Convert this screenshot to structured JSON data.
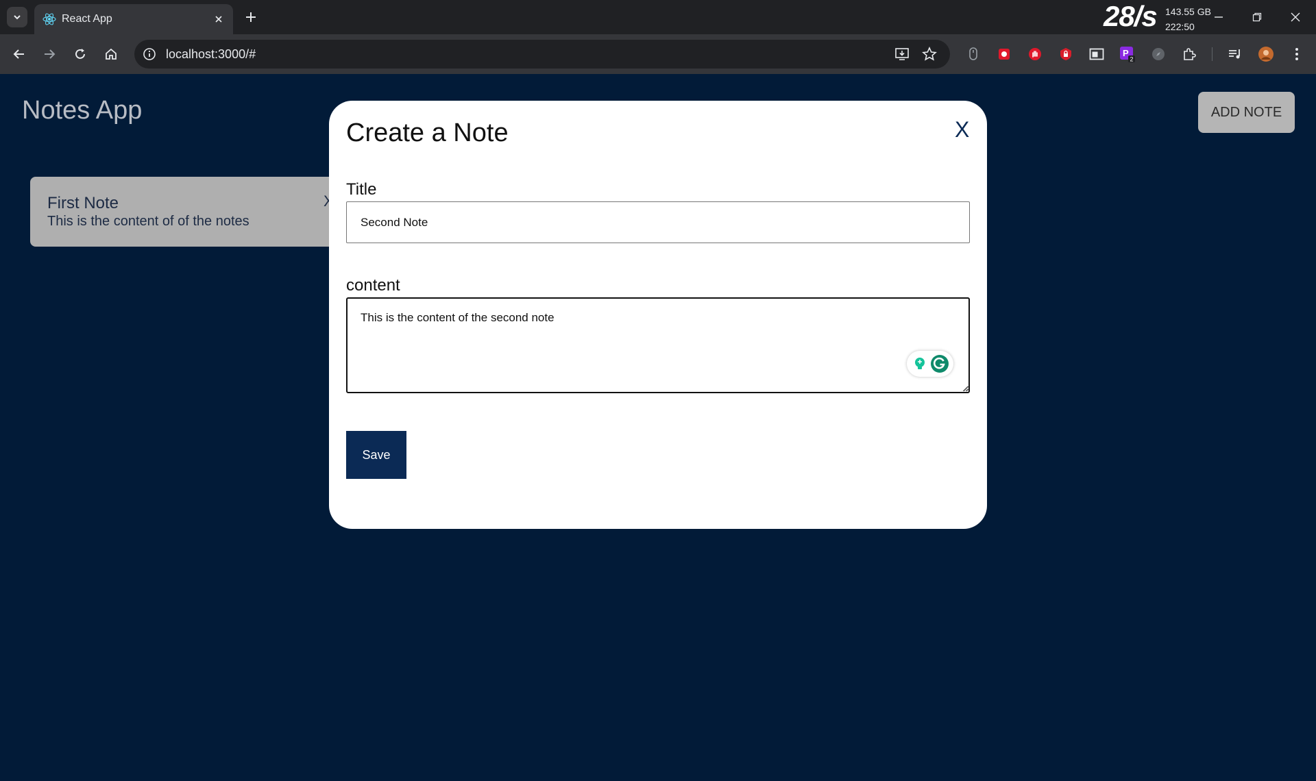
{
  "browser": {
    "tab_title": "React App",
    "url": "localhost:3000/#",
    "net_speed": "28/s",
    "disk": "143.55 GB",
    "clock": "222:50",
    "extension_badge": "2",
    "extension_letter": "P"
  },
  "app": {
    "title": "Notes App",
    "add_note_label": "ADD NOTE",
    "notes": [
      {
        "title": "First Note",
        "content": "This is the content of of the notes",
        "close": "X"
      }
    ]
  },
  "modal": {
    "heading": "Create a Note",
    "close": "X",
    "title_label": "Title",
    "title_value": "Second Note",
    "content_label": "content",
    "content_value": "This is the content of the second note",
    "save_label": "Save"
  }
}
